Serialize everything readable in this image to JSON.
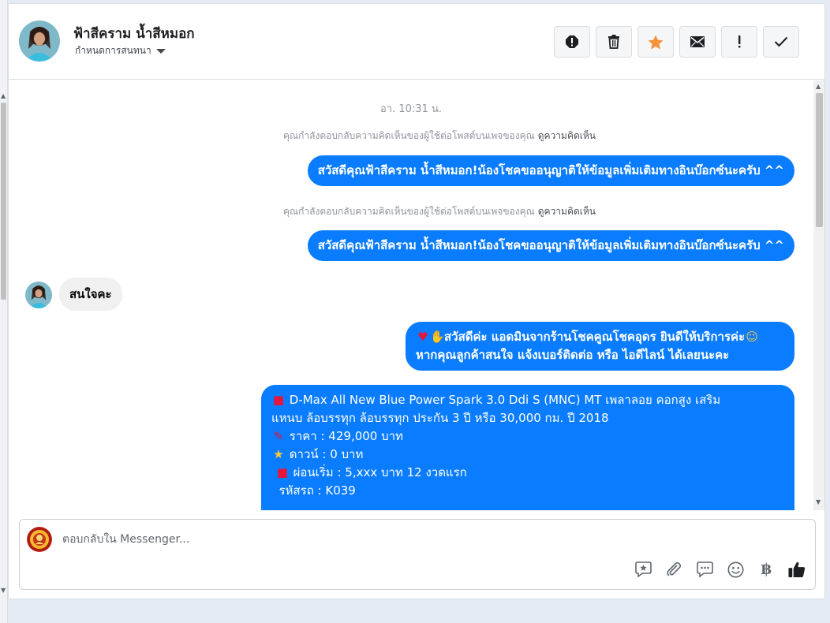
{
  "header": {
    "contact_name": "ฟ้าสีคราม น้ำสีหมอก",
    "conversation_settings": "กำหนดการสนทนา",
    "actions": [
      {
        "name": "report",
        "icon": "alert-circle-icon"
      },
      {
        "name": "delete",
        "icon": "trash-icon"
      },
      {
        "name": "star",
        "icon": "star-icon"
      },
      {
        "name": "mark-unread",
        "icon": "envelope-icon"
      },
      {
        "name": "important",
        "icon": "exclamation-icon"
      },
      {
        "name": "done",
        "icon": "check-icon"
      }
    ]
  },
  "thread": {
    "timestamp": "อา. 10:31 น.",
    "reply_notice_text": "คุณกำลังตอบกลับความคิดเห็นของผู้ใช้ต่อโพสต์บนเพจของคุณ",
    "reply_notice_link": "ดูความคิดเห็น",
    "messages": [
      {
        "from": "page",
        "text": "สวัสดีคุณฟ้าสีคราม น้ำสีหมอก!น้องโชคขออนุญาติให้ข้อมูลเพิ่มเติมทางอินบ๊อกซ์นะครับ ^^"
      },
      {
        "from": "page",
        "text": "สวัสดีคุณฟ้าสีคราม น้ำสีหมอก!น้องโชคขออนุญาติให้ข้อมูลเพิ่มเติมทางอินบ๊อกซ์นะครับ ^^"
      },
      {
        "from": "user",
        "text": "สนใจคะ"
      },
      {
        "from": "page",
        "lines": [
          "สวัสดีค่ะ แอดมินจากร้านโชคคูณโชคอุดร ยินดีให้บริการค่ะ",
          "หากคุณลูกค้าสนใจ แจ้งเบอร์ติดต่อ หรือ ไอดีไลน์ ได้เลยนะคะ"
        ]
      },
      {
        "from": "page",
        "lines": [
          "D-Max All New Blue Power Spark 3.0 Ddi S (MNC) MT เพลาลอย คอกสูง เสริม",
          "แหนบ ล้อบรรทุก ล้อบรรทุก ประกัน 3 ปี หรือ 30,000 กม. ปี 2018",
          "ราคา : 429,000 บาท",
          "ดาวน์ : 0 บาท",
          "ผ่อนเริ่ม : 5,xxx บาท 12 งวดแรก",
          "รหัสรถ : K039"
        ]
      }
    ]
  },
  "composer": {
    "placeholder": "ตอบกลับใน Messenger...",
    "tools": [
      "saved-reply-icon",
      "attachment-icon",
      "chat-bubble-icon",
      "emoji-icon",
      "baht-icon",
      "thumbs-up-icon"
    ],
    "currency_symbol": "฿"
  },
  "colors": {
    "outgoing_bubble": "#0a7cff",
    "incoming_bubble": "#f0f0f0",
    "star_action": "#f7923b"
  }
}
